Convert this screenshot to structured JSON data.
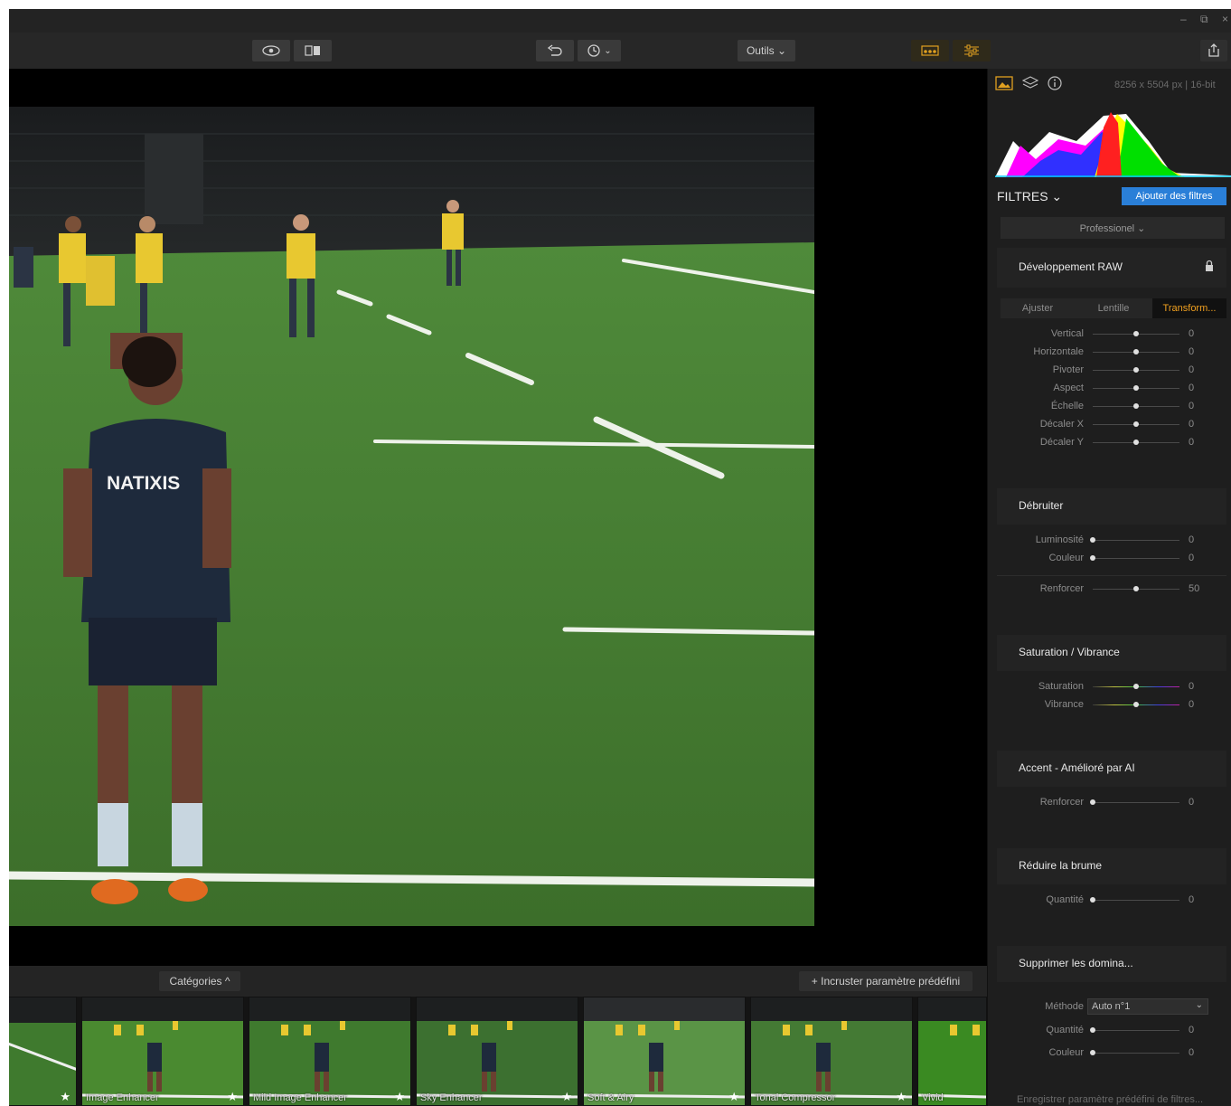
{
  "app": {
    "window_controls": [
      "–",
      "⧉",
      "×"
    ]
  },
  "toolbar": {
    "tools_label": "Outils ⌄",
    "history_label": "⌄"
  },
  "panel": {
    "image_info": "8256 x 5504 px  |  16-bit",
    "filters_title": "FILTRES ⌄",
    "add_filters_label": "Ajouter des filtres",
    "preset_mode": "Professionel ⌄",
    "raw": {
      "title": "Développement RAW",
      "tabs": [
        "Ajuster",
        "Lentille",
        "Transform..."
      ],
      "active_tab": 2,
      "sliders": [
        {
          "label": "Vertical",
          "value": "0",
          "level": 0.5
        },
        {
          "label": "Horizontale",
          "value": "0",
          "level": 0.5
        },
        {
          "label": "Pivoter",
          "value": "0",
          "level": 0.5
        },
        {
          "label": "Aspect",
          "value": "0",
          "level": 0.5
        },
        {
          "label": "Échelle",
          "value": "0",
          "level": 0.5
        },
        {
          "label": "Décaler X",
          "value": "0",
          "level": 0.5
        },
        {
          "label": "Décaler Y",
          "value": "0",
          "level": 0.5
        }
      ]
    },
    "denoise": {
      "title": "Débruiter",
      "sliders": [
        {
          "label": "Luminosité",
          "value": "0",
          "level": 0.0
        },
        {
          "label": "Couleur",
          "value": "0",
          "level": 0.0
        }
      ],
      "boost": {
        "label": "Renforcer",
        "value": "50",
        "level": 0.5
      }
    },
    "saturation": {
      "title": "Saturation / Vibrance",
      "sliders": [
        {
          "label": "Saturation",
          "value": "0",
          "level": 0.5
        },
        {
          "label": "Vibrance",
          "value": "0",
          "level": 0.5
        }
      ]
    },
    "accent": {
      "title": "Accent - Amélioré par AI",
      "sliders": [
        {
          "label": "Renforcer",
          "value": "0",
          "level": 0.0
        }
      ]
    },
    "haze": {
      "title": "Réduire la brume",
      "sliders": [
        {
          "label": "Quantité",
          "value": "0",
          "level": 0.0
        }
      ]
    },
    "remove_cast": {
      "title": "Supprimer les domina...",
      "method_label": "Méthode",
      "method_value": "Auto n°1",
      "sliders": [
        {
          "label": "Quantité",
          "value": "0",
          "level": 0.0
        },
        {
          "label": "Couleur",
          "value": "0",
          "level": 0.0
        }
      ]
    },
    "save_preset_label": "Enregistrer paramètre prédéfini de filtres..."
  },
  "bottombar": {
    "categories_label": "Catégories ^",
    "embed_preset_label": "+ Incruster paramètre prédéfini"
  },
  "presets": [
    {
      "name": ""
    },
    {
      "name": "Image Enhancer"
    },
    {
      "name": "Mild Image Enhancer"
    },
    {
      "name": "Sky Enhancer"
    },
    {
      "name": "Soft & Airy"
    },
    {
      "name": "Tonal Compressor"
    },
    {
      "name": "Vivid"
    }
  ],
  "photo": {
    "shirt_text": "NATIXIS"
  },
  "colors": {
    "accent_blue": "#2a7fd8",
    "active_tab_orange": "#f0a020"
  }
}
